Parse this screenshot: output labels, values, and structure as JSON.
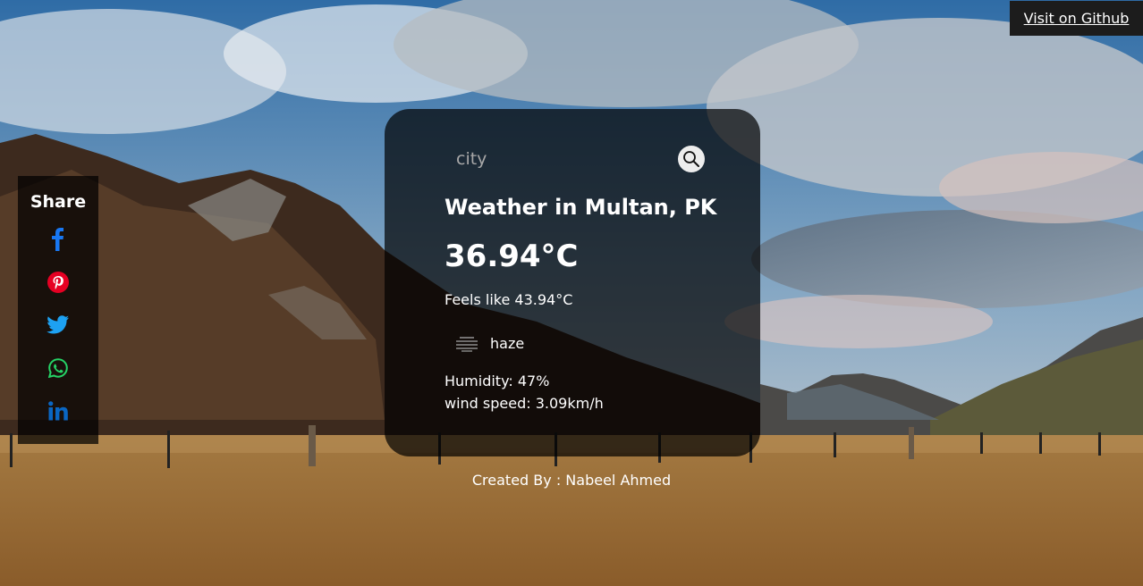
{
  "header": {
    "github_link_label": "Visit on Github"
  },
  "share": {
    "title": "Share",
    "items": [
      {
        "name": "facebook",
        "icon": "facebook-icon",
        "color": "#1877f2"
      },
      {
        "name": "pinterest",
        "icon": "pinterest-icon",
        "color": "#e60023"
      },
      {
        "name": "twitter",
        "icon": "twitter-icon",
        "color": "#1da1f2"
      },
      {
        "name": "whatsapp",
        "icon": "whatsapp-icon",
        "color": "#25d366"
      },
      {
        "name": "linkedin",
        "icon": "linkedin-icon",
        "color": "#0a66c2"
      }
    ]
  },
  "weather": {
    "search_placeholder": "city",
    "search_icon": "search-icon",
    "title": "Weather in Multan, PK",
    "temperature": "36.94°C",
    "feels_like": "Feels like 43.94°C",
    "condition": "haze",
    "condition_icon": "haze-icon",
    "humidity": "Humidity: 47%",
    "wind_speed": "wind speed: 3.09km/h"
  },
  "footer": {
    "credit": "Created By : Nabeel Ahmed"
  },
  "colors": {
    "card_background": "rgba(0,0,0,0.7)",
    "github_background": "#1c1c1c",
    "text": "#ffffff"
  }
}
